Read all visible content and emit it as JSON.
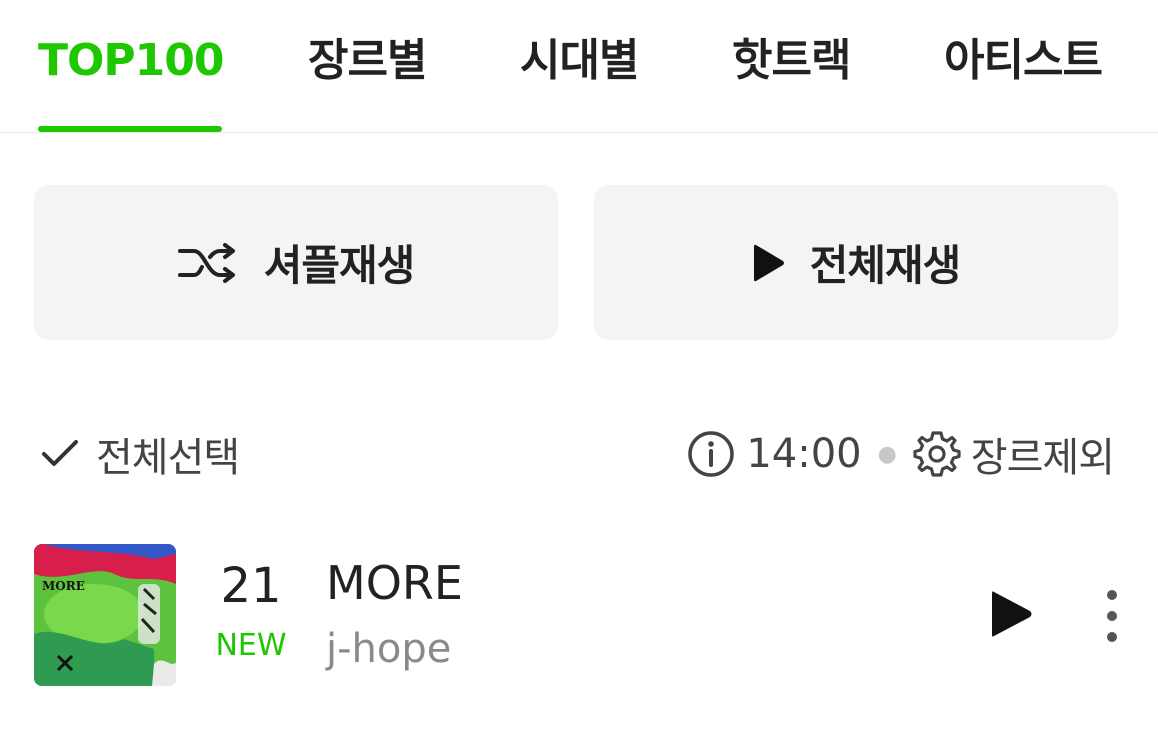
{
  "tabs": [
    {
      "label": "TOP100",
      "active": true
    },
    {
      "label": "장르별",
      "active": false
    },
    {
      "label": "시대별",
      "active": false
    },
    {
      "label": "핫트랙",
      "active": false
    },
    {
      "label": "아티스트",
      "active": false
    }
  ],
  "actions": {
    "shuffle_label": "셔플재생",
    "play_all_label": "전체재생"
  },
  "options": {
    "select_all_label": "전체선택",
    "chart_time": "14:00",
    "genre_exclude_label": "장르제외"
  },
  "tracks": [
    {
      "rank": "21",
      "rank_status": "NEW",
      "title": "MORE",
      "artist": "j-hope",
      "cover_text": "MORE"
    }
  ],
  "colors": {
    "accent": "#1ec800",
    "button_bg": "#f4f4f4",
    "text_primary": "#222222",
    "text_secondary": "#8a8a8a"
  },
  "icons": [
    "shuffle-icon",
    "play-icon",
    "check-icon",
    "info-icon",
    "gear-icon",
    "more-vertical-icon"
  ]
}
